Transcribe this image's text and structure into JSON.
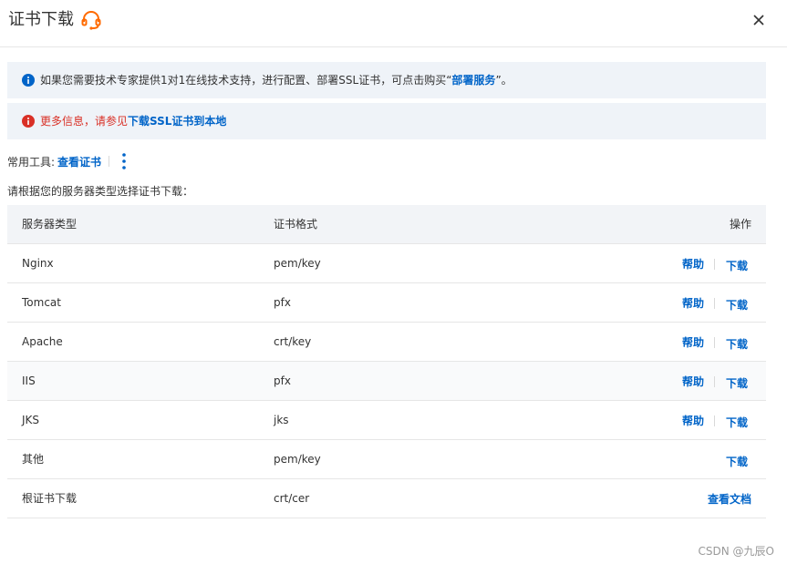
{
  "dialog": {
    "title": "证书下载",
    "close_icon": "close-icon",
    "support_icon": "headset-icon"
  },
  "notices": [
    {
      "text_before": "如果您需要技术专家提供1对1在线技术支持，进行配置、部署SSL证书，可点击购买“",
      "link_text": "部署服务",
      "text_after": "”。"
    },
    {
      "red_text": "更多信息，请参见",
      "link_text": "下载SSL证书到本地"
    }
  ],
  "tools": {
    "label": "常用工具:",
    "view_cert_link": "查看证书",
    "more_icon": "more-vertical-icon"
  },
  "instruction": "请根据您的服务器类型选择证书下载：",
  "table": {
    "headers": [
      "服务器类型",
      "证书格式",
      "操作"
    ],
    "rows": [
      {
        "server": "Nginx",
        "format": "pem/key",
        "help": "帮助",
        "download": "下载"
      },
      {
        "server": "Tomcat",
        "format": "pfx",
        "help": "帮助",
        "download": "下载"
      },
      {
        "server": "Apache",
        "format": "crt/key",
        "help": "帮助",
        "download": "下载"
      },
      {
        "server": "IIS",
        "format": "pfx",
        "help": "帮助",
        "download": "下载"
      },
      {
        "server": "JKS",
        "format": "jks",
        "help": "帮助",
        "download": "下载"
      },
      {
        "server": "其他",
        "format": "pem/key",
        "download": "下载"
      },
      {
        "server": "根证书下载",
        "format": "crt/cer",
        "doc": "查看文档"
      }
    ]
  },
  "watermark": "CSDN @九辰O",
  "colors": {
    "link": "#0064c8",
    "red": "#d93026",
    "notice_bg": "#eff3f8",
    "accent_orange": "#ff6a00"
  }
}
